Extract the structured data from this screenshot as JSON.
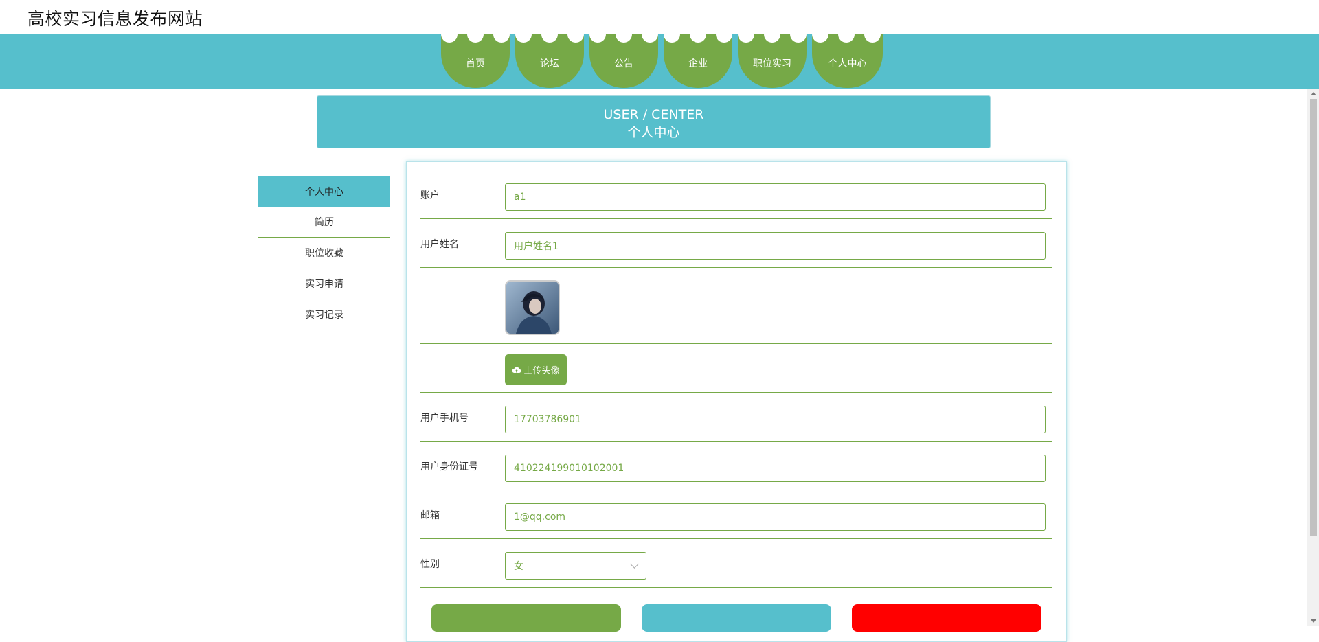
{
  "site": {
    "title": "高校实习信息发布网站"
  },
  "nav": {
    "items": [
      {
        "label": "首页"
      },
      {
        "label": "论坛"
      },
      {
        "label": "公告"
      },
      {
        "label": "企业"
      },
      {
        "label": "职位实习"
      },
      {
        "label": "个人中心"
      }
    ]
  },
  "banner": {
    "en": "USER / CENTER",
    "cn": "个人中心"
  },
  "sidebar": {
    "items": [
      {
        "label": "个人中心",
        "active": true
      },
      {
        "label": "简历"
      },
      {
        "label": "职位收藏"
      },
      {
        "label": "实习申请"
      },
      {
        "label": "实习记录"
      }
    ]
  },
  "form": {
    "account": {
      "label": "账户",
      "value": "a1"
    },
    "username": {
      "label": "用户姓名",
      "value": "用户姓名1"
    },
    "upload": {
      "label": "上传头像",
      "icon": "cloud-upload-icon"
    },
    "phone": {
      "label": "用户手机号",
      "value": "17703786901"
    },
    "idcard": {
      "label": "用户身份证号",
      "value": "410224199010102001"
    },
    "email": {
      "label": "邮箱",
      "value": "1@qq.com"
    },
    "gender": {
      "label": "性别",
      "value": "女"
    }
  },
  "colors": {
    "primary_green": "#76a947",
    "accent_teal": "#56bfcc",
    "danger_red": "#ff0000"
  }
}
